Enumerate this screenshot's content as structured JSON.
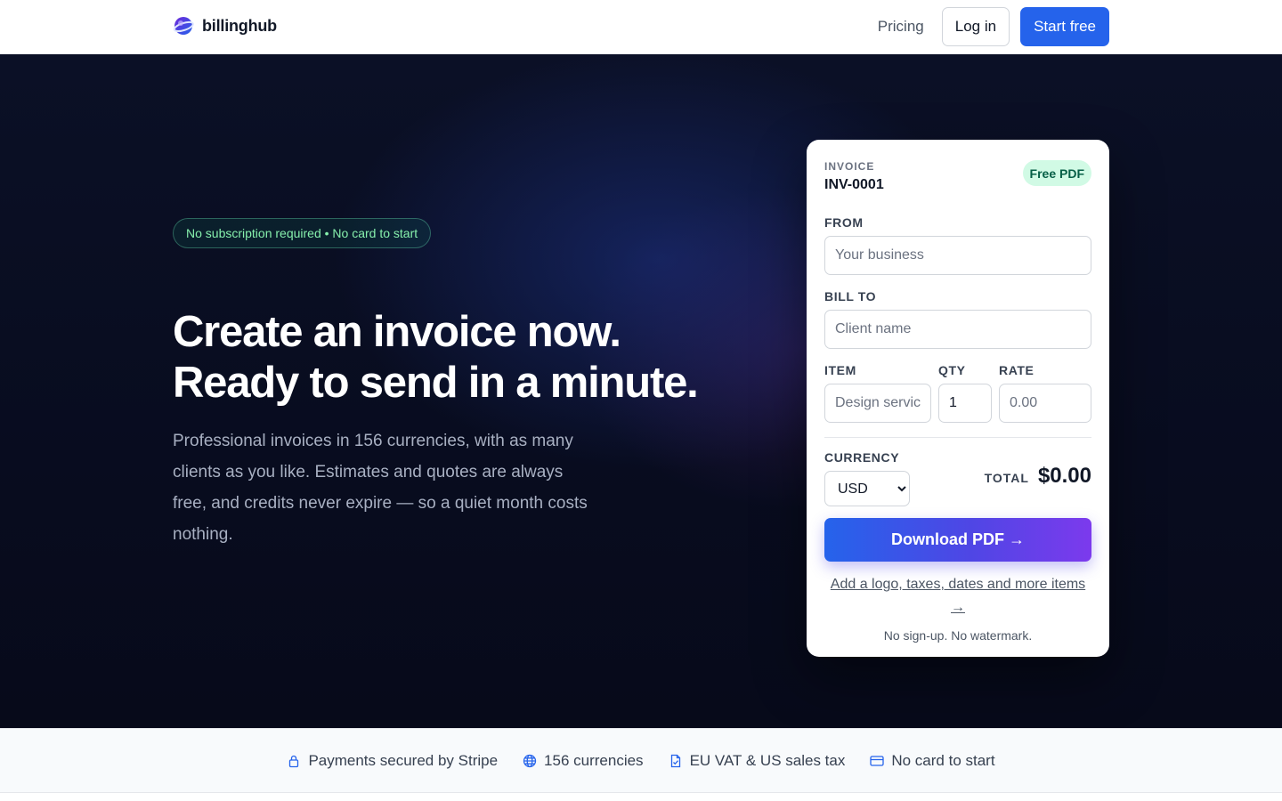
{
  "header": {
    "brand_name": "billinghub",
    "nav_pricing": "Pricing",
    "login_label": "Log in",
    "start_label": "Start free"
  },
  "hero": {
    "pill_text": "No subscription required • No card to start",
    "headline_line1": "Create an invoice now.",
    "headline_line2": "Ready to send in a minute.",
    "subcopy": "Professional invoices in 156 currencies, with as many clients as you like. Estimates and quotes are always free, and credits never expire — so a quiet month costs nothing."
  },
  "invoice": {
    "label": "INVOICE",
    "number": "INV-0001",
    "badge": "Free PDF",
    "from_label": "FROM",
    "from_placeholder": "Your business",
    "bill_to_label": "BILL TO",
    "bill_to_placeholder": "Client name",
    "item_label": "ITEM",
    "item_placeholder": "Design services",
    "qty_label": "QTY",
    "qty_value": "1",
    "rate_label": "RATE",
    "rate_placeholder": "0.00",
    "currency_label": "CURRENCY",
    "currency_selected": "USD",
    "total_label": "TOTAL",
    "total_value": "$0.00",
    "download_label": "Download PDF →",
    "more_link": "Add a logo, taxes, dates and more items →",
    "fine_print": "No sign-up. No watermark."
  },
  "trust": {
    "items": [
      {
        "icon": "lock-icon",
        "label": "Payments secured by Stripe"
      },
      {
        "icon": "globe-icon",
        "label": "156 currencies"
      },
      {
        "icon": "document-check-icon",
        "label": "EU VAT & US sales tax"
      },
      {
        "icon": "credit-card-icon",
        "label": "No card to start"
      }
    ]
  },
  "colors": {
    "accent": "#2563eb",
    "hero_bg": "#0b1026",
    "badge_bg": "#d1fae5",
    "pill_text": "#86efac"
  }
}
